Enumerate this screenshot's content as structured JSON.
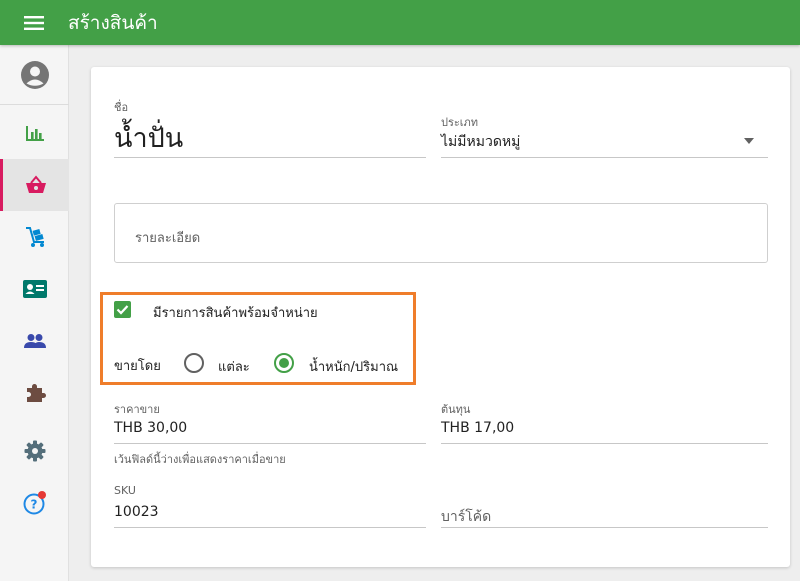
{
  "topbar": {
    "title": "สร้างสินค้า"
  },
  "sidebar": {
    "items": [
      {
        "icon": "account-icon"
      },
      {
        "icon": "bar-chart-icon"
      },
      {
        "icon": "basket-icon"
      },
      {
        "icon": "hand-truck-icon"
      },
      {
        "icon": "id-card-icon"
      },
      {
        "icon": "people-icon"
      },
      {
        "icon": "puzzle-icon"
      },
      {
        "icon": "gear-icon"
      },
      {
        "icon": "help-icon"
      }
    ]
  },
  "form": {
    "name_label": "ชื่อ",
    "name_value": "น้ำปั่น",
    "category_label": "ประเภท",
    "category_value": "ไม่มีหมวดหมู่",
    "description_placeholder": "รายละเอียด",
    "available_label": "มีรายการสินค้าพร้อมจำหน่าย",
    "available_checked": true,
    "sell_by_label": "ขายโดย",
    "sell_by_options": [
      "แต่ละ",
      "น้ำหนัก/ปริมาณ"
    ],
    "sell_by_selected": "น้ำหนัก/ปริมาณ",
    "price_label": "ราคาขาย",
    "price_value": "THB 30,00",
    "price_helper": "เว้นฟิลด์นี้ว่างเพื่อแสดงราคาเมื่อขาย",
    "cost_label": "ต้นทุน",
    "cost_value": "THB 17,00",
    "sku_label": "SKU",
    "sku_value": "10023",
    "barcode_placeholder": "บาร์โค้ด"
  },
  "colors": {
    "topbar": "#43a047",
    "accent": "#43a047",
    "active_indicator": "#d81b60",
    "highlight_border": "#ef7d2a"
  }
}
